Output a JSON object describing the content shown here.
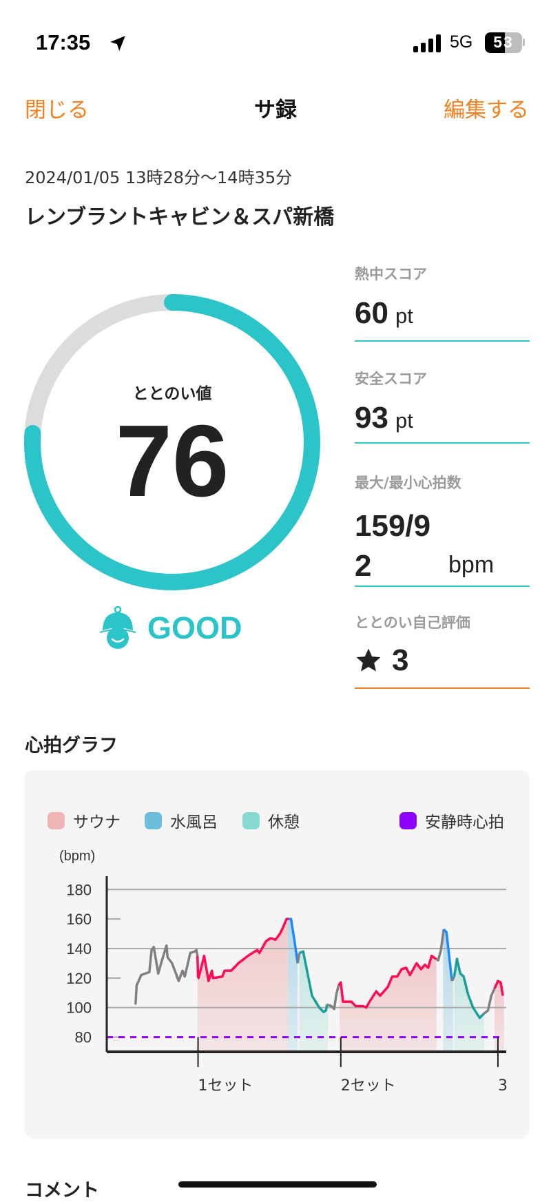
{
  "status_bar": {
    "time": "17:35",
    "network": "5G",
    "battery": "53",
    "icons": [
      "location-arrow-icon",
      "signal-icon",
      "battery-icon"
    ]
  },
  "nav": {
    "close_label": "閉じる",
    "title": "サ録",
    "edit_label": "編集する",
    "accent_color": "#f7801e"
  },
  "session": {
    "datetime": "2024/01/05 13時28分〜14時35分",
    "venue": "レンブラントキャビン＆スパ新橋"
  },
  "totonoi": {
    "label": "ととのい値",
    "value": "76",
    "progress_percent": 76,
    "rating": "GOOD",
    "rating_icon": "sauna-hat-face-icon",
    "ring_color": "#2bc4c8",
    "ring_track_color": "#dcdcdc"
  },
  "stats": [
    {
      "label": "熱中スコア",
      "value": "60",
      "unit": "pt"
    },
    {
      "label": "安全スコア",
      "value": "93",
      "unit": "pt"
    },
    {
      "label": "最大/最小心拍数",
      "value": "159/92",
      "unit": "bpm"
    },
    {
      "label": "ととのい自己評価",
      "value": "3",
      "icon": "star-icon"
    }
  ],
  "heart_graph": {
    "title": "心拍グラフ"
  },
  "comment": {
    "title": "コメント"
  },
  "chart_data": {
    "type": "line",
    "ylabel": "(bpm)",
    "ylim": [
      70,
      189
    ],
    "y_ticks": [
      "180",
      "160",
      "140",
      "120",
      "100",
      "80"
    ],
    "y_tick_values": [
      180,
      160,
      140,
      120,
      100,
      80
    ],
    "gridlines": [
      180,
      140,
      100
    ],
    "x_ticks": [
      {
        "label": "1セット",
        "x": 11.3
      },
      {
        "label": "2セット",
        "x": 37.1
      },
      {
        "label": "3",
        "x": 65.5
      }
    ],
    "xlim": [
      -5.2,
      67
    ],
    "legend": [
      {
        "name": "サウナ",
        "color": "#f0b4b4"
      },
      {
        "name": "水風呂",
        "color": "#6bbfdc"
      },
      {
        "name": "休憩",
        "color": "#86d9cf"
      },
      {
        "name": "安静時心拍",
        "color": "#8b00ff"
      }
    ],
    "resting_hr": 80,
    "line_colors": {
      "none": "#808080",
      "sauna": "#ff0a54",
      "cold": "#1e88ff",
      "rest": "#1a9e9a"
    },
    "fill_colors": {
      "sauna": "#f0c3c5",
      "cold": "#add6e8",
      "rest": "#bfe6df"
    },
    "phases": [
      {
        "type": "sauna",
        "start": 11.2,
        "end": 27.5
      },
      {
        "type": "cold",
        "start": 27.5,
        "end": 29.3
      },
      {
        "type": "rest",
        "start": 29.6,
        "end": 34.8
      },
      {
        "type": "sauna",
        "start": 36.9,
        "end": 54.4
      },
      {
        "type": "cold",
        "start": 55.6,
        "end": 57.4
      },
      {
        "type": "rest",
        "start": 57.6,
        "end": 63.0
      },
      {
        "type": "sauna",
        "start": 64.9,
        "end": 66.6
      }
    ],
    "points": [
      [
        0,
        102
      ],
      [
        0.2,
        115
      ],
      [
        0.8,
        120
      ],
      [
        1.0,
        122
      ],
      [
        2.5,
        124
      ],
      [
        2.9,
        139
      ],
      [
        3.3,
        141
      ],
      [
        4.1,
        123
      ],
      [
        4.7,
        131
      ],
      [
        5.1,
        136
      ],
      [
        5.6,
        142
      ],
      [
        5.8,
        134
      ],
      [
        6.6,
        130
      ],
      [
        7.8,
        118
      ],
      [
        8.5,
        125
      ],
      [
        8.9,
        121
      ],
      [
        9.9,
        137
      ],
      [
        10.7,
        138
      ],
      [
        11.0,
        139
      ],
      [
        11.2,
        135
      ],
      [
        11.3,
        121
      ],
      [
        11.4,
        120
      ],
      [
        12.4,
        135
      ],
      [
        13.2,
        118
      ],
      [
        13.8,
        125
      ],
      [
        14.0,
        120
      ],
      [
        15.7,
        121
      ],
      [
        16.1,
        125
      ],
      [
        17.3,
        125
      ],
      [
        18.6,
        130
      ],
      [
        20.3,
        135
      ],
      [
        22.0,
        139
      ],
      [
        22.4,
        137
      ],
      [
        23.6,
        145
      ],
      [
        24.4,
        147
      ],
      [
        25.3,
        146
      ],
      [
        26.1,
        150
      ],
      [
        26.5,
        153
      ],
      [
        27.3,
        160
      ],
      [
        27.7,
        160
      ],
      [
        28.1,
        160
      ],
      [
        28.7,
        146
      ],
      [
        29.3,
        130
      ],
      [
        29.6,
        137
      ],
      [
        30.3,
        138
      ],
      [
        31.1,
        123
      ],
      [
        31.9,
        108
      ],
      [
        33.2,
        100
      ],
      [
        34.0,
        97
      ],
      [
        34.4,
        98
      ],
      [
        34.6,
        102
      ],
      [
        35.4,
        101
      ],
      [
        35.9,
        99
      ],
      [
        36.3,
        109
      ],
      [
        36.7,
        115
      ],
      [
        37.1,
        117
      ],
      [
        37.5,
        104
      ],
      [
        39.0,
        104
      ],
      [
        39.8,
        101
      ],
      [
        41.1,
        101
      ],
      [
        41.7,
        100
      ],
      [
        42.3,
        104
      ],
      [
        43.5,
        111
      ],
      [
        44.2,
        108
      ],
      [
        45.6,
        114
      ],
      [
        46.4,
        121
      ],
      [
        47.3,
        121
      ],
      [
        48.1,
        126
      ],
      [
        48.9,
        127
      ],
      [
        49.6,
        122
      ],
      [
        50.8,
        130
      ],
      [
        51.6,
        126
      ],
      [
        52.3,
        129
      ],
      [
        52.9,
        127
      ],
      [
        53.5,
        135
      ],
      [
        54.3,
        133
      ],
      [
        54.7,
        132
      ],
      [
        55.2,
        139
      ],
      [
        55.7,
        153
      ],
      [
        56.2,
        151
      ],
      [
        56.8,
        131
      ],
      [
        57.2,
        118
      ],
      [
        57.6,
        121
      ],
      [
        58.1,
        133
      ],
      [
        58.7,
        123
      ],
      [
        59.3,
        121
      ],
      [
        60.1,
        109
      ],
      [
        61.0,
        100
      ],
      [
        62.2,
        93
      ],
      [
        63.0,
        96
      ],
      [
        63.7,
        98
      ],
      [
        64.3,
        108
      ],
      [
        64.9,
        113
      ],
      [
        65.5,
        118
      ],
      [
        66.0,
        117
      ],
      [
        66.4,
        108
      ]
    ]
  }
}
